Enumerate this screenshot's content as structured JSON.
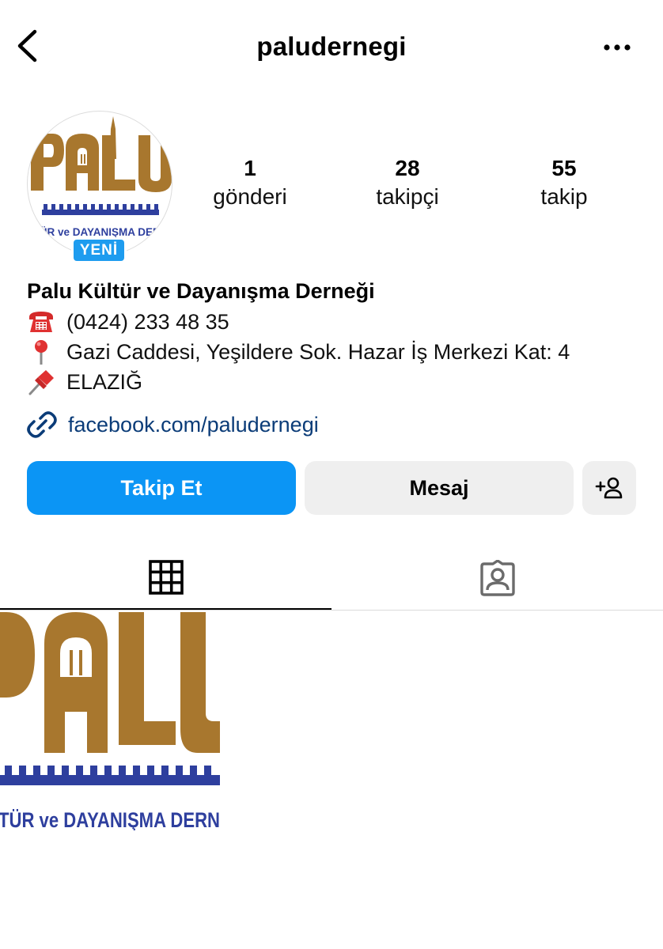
{
  "header": {
    "username": "paludernegi"
  },
  "profile": {
    "new_badge": "YENİ",
    "logo_text": "PALU",
    "logo_subtext": "TÜR ve DAYANIŞMA DERN"
  },
  "stats": [
    {
      "value": "1",
      "label": "gönderi"
    },
    {
      "value": "28",
      "label": "takipçi"
    },
    {
      "value": "55",
      "label": "takip"
    }
  ],
  "bio": {
    "name": "Palu Kültür ve Dayanışma Derneği",
    "lines": [
      {
        "icon": "telephone-icon",
        "text": "(0424) 233 48 35"
      },
      {
        "icon": "round-pushpin-icon",
        "text": "Gazi Caddesi, Yeşildere Sok. Hazar İş Merkezi Kat: 4"
      },
      {
        "icon": "pushpin-icon",
        "text": "ELAZIĞ"
      }
    ],
    "link": "facebook.com/paludernegi"
  },
  "actions": {
    "follow_label": "Takip Et",
    "message_label": "Mesaj"
  },
  "posts": [
    {
      "logo_text": "PALU",
      "subtext": "TÜR ve DAYANIŞMA DERN"
    }
  ],
  "colors": {
    "follow_button": "#0b95f5",
    "new_badge": "#1e9cef",
    "link": "#0b3c78",
    "logo_brown": "#a8772e",
    "logo_blue": "#2e3f9e"
  }
}
